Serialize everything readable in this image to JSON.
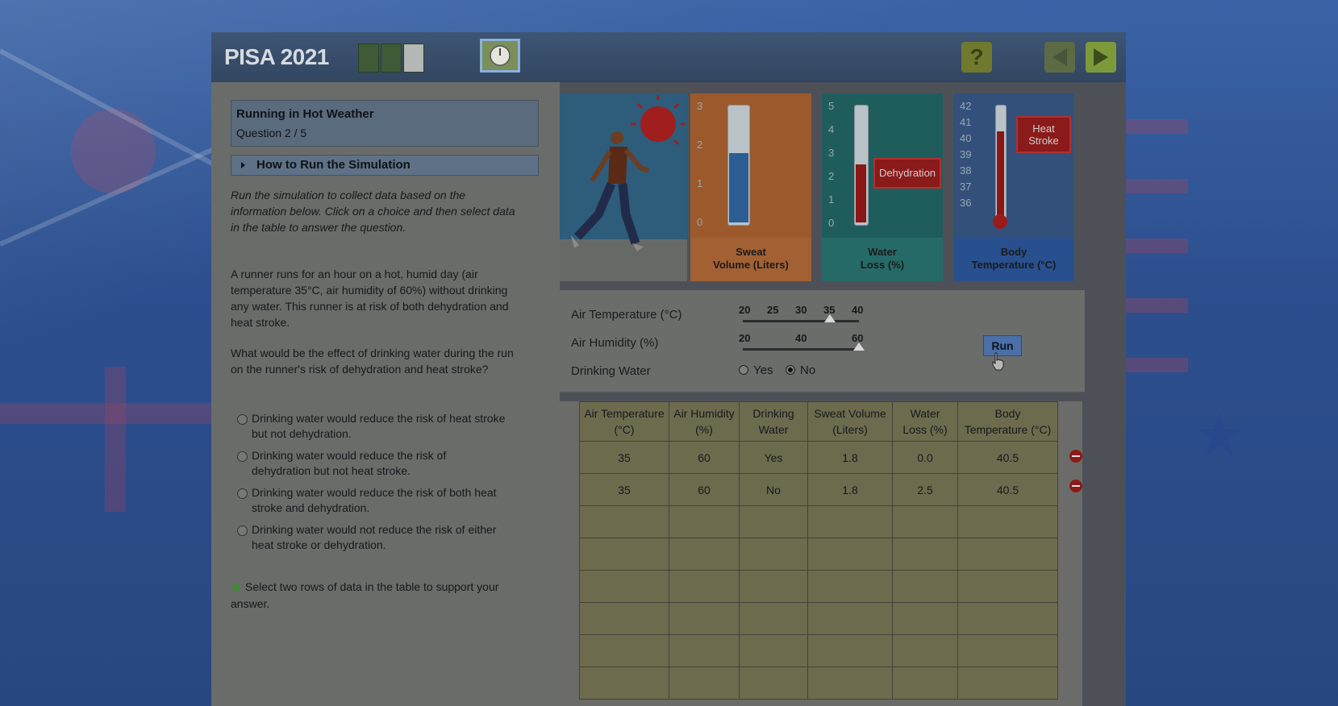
{
  "header": {
    "logo": "PISA 2021",
    "progress_segments": 3,
    "current_segment": 3
  },
  "question": {
    "title": "Running in Hot Weather",
    "number": "Question 2 / 5",
    "howto_label": "How to Run the Simulation",
    "intro_lines": [
      "Run the simulation to collect data based on the",
      "information below. Click on a choice and then select data",
      "in the table to answer the question."
    ],
    "runner_lines": [
      "A runner runs for an hour on a hot, humid day (air",
      "temperature 35°C, air humidity of 60%) without drinking",
      "any water. This runner is at risk of both dehydration and",
      "heat stroke."
    ],
    "question_lines": [
      "What would be the effect of drinking water during the run",
      "on the runner's risk of dehydration and heat stroke?"
    ],
    "choices": [
      {
        "line1": "Drinking water would reduce the risk of heat stroke",
        "line2": "but not dehydration."
      },
      {
        "line1": "Drinking water would reduce the risk of",
        "line2": "dehydration but not heat stroke."
      },
      {
        "line1": "Drinking water would reduce the risk of both heat",
        "line2": "stroke and dehydration."
      },
      {
        "line1": "Drinking water would not reduce the risk of either",
        "line2": "heat stroke or dehydration."
      }
    ],
    "instruction_line1": "Select two rows of data in the table to support your",
    "instruction_line2": "answer."
  },
  "gauges": {
    "sweat": {
      "label_line1": "Sweat",
      "label_line2": "Volume (Liters)",
      "ticks": [
        "3",
        "2",
        "1",
        "0"
      ],
      "value": 1.8,
      "max": 3
    },
    "water": {
      "label_line1": "Water",
      "label_line2": "Loss (%)",
      "ticks": [
        "5",
        "4",
        "3",
        "2",
        "1",
        "0"
      ],
      "value": 2.5,
      "max": 5,
      "tag": "Dehydration"
    },
    "body": {
      "label_line1": "Body",
      "label_line2": "Temperature (°C)",
      "ticks": [
        "42",
        "41",
        "40",
        "39",
        "38",
        "37",
        "36"
      ],
      "value": 40.5,
      "tag_line1": "Heat",
      "tag_line2": "Stroke"
    }
  },
  "controls": {
    "air_temp_label": "Air Temperature (°C)",
    "air_temp_scale": [
      "20",
      "25",
      "30",
      "35",
      "40"
    ],
    "air_temp_value": 35,
    "air_humidity_label": "Air Humidity (%)",
    "air_humidity_scale": [
      "20",
      "40",
      "60"
    ],
    "air_humidity_value": 60,
    "drinking_label": "Drinking Water",
    "yes_label": "Yes",
    "no_label": "No",
    "drinking_selected": "No",
    "run_label": "Run"
  },
  "table": {
    "headers": [
      {
        "l1": "Air Temperature",
        "l2": "(°C)"
      },
      {
        "l1": "Air Humidity",
        "l2": "(%)"
      },
      {
        "l1": "Drinking",
        "l2": "Water"
      },
      {
        "l1": "Sweat Volume",
        "l2": "(Liters)"
      },
      {
        "l1": "Water",
        "l2": "Loss (%)"
      },
      {
        "l1": "Body",
        "l2": "Temperature (°C)"
      }
    ],
    "rows": [
      [
        "35",
        "60",
        "Yes",
        "1.8",
        "0.0",
        "40.5"
      ],
      [
        "35",
        "60",
        "No",
        "1.8",
        "2.5",
        "40.5"
      ],
      [
        "",
        "",
        "",
        "",
        "",
        ""
      ],
      [
        "",
        "",
        "",
        "",
        "",
        ""
      ],
      [
        "",
        "",
        "",
        "",
        "",
        ""
      ],
      [
        "",
        "",
        "",
        "",
        "",
        ""
      ],
      [
        "",
        "",
        "",
        "",
        "",
        ""
      ],
      [
        "",
        "",
        "",
        "",
        "",
        ""
      ]
    ]
  }
}
